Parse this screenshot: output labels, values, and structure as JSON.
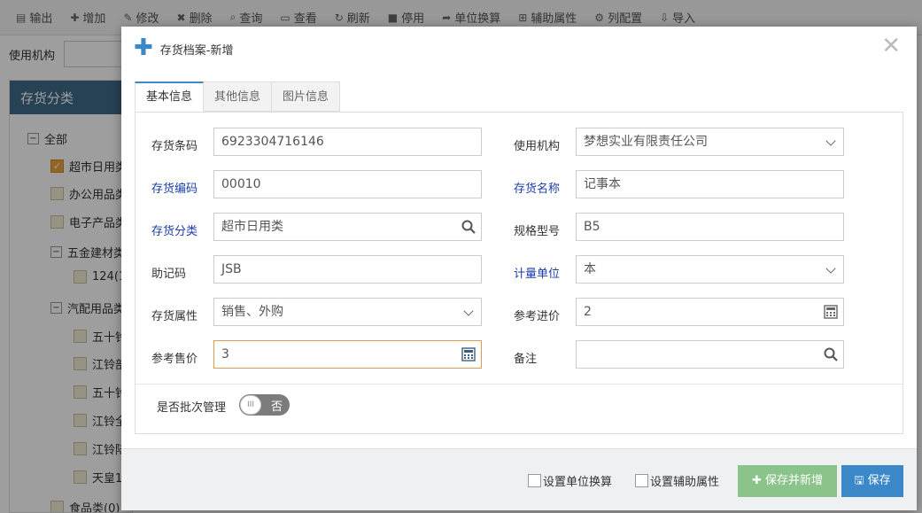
{
  "toolbar": {
    "items": [
      {
        "icon": "export-icon",
        "glyph": "▤",
        "label": "输出"
      },
      {
        "icon": "add-icon",
        "glyph": "✚",
        "label": "增加"
      },
      {
        "icon": "edit-icon",
        "glyph": "✎",
        "label": "修改"
      },
      {
        "icon": "delete-icon",
        "glyph": "✖",
        "label": "删除"
      },
      {
        "icon": "search-icon",
        "glyph": "⌕",
        "label": "查询"
      },
      {
        "icon": "view-icon",
        "glyph": "▭",
        "label": "查看"
      },
      {
        "icon": "refresh-icon",
        "glyph": "↻",
        "label": "刷新"
      },
      {
        "icon": "disable-icon",
        "glyph": "■",
        "label": "停用"
      },
      {
        "icon": "share-icon",
        "glyph": "➦",
        "label": "单位换算"
      },
      {
        "icon": "sitemap-icon",
        "glyph": "⊞",
        "label": "辅助属性"
      },
      {
        "icon": "gear-icon",
        "glyph": "⚙",
        "label": "列配置"
      },
      {
        "icon": "import-icon",
        "glyph": "⇩",
        "label": "导入"
      }
    ]
  },
  "org_filter": {
    "label": "使用机构",
    "value": ""
  },
  "tree": {
    "title": "存货分类",
    "nodes": [
      {
        "text": "全部"
      },
      {
        "text": "超市日用类"
      },
      {
        "text": "办公用品类"
      },
      {
        "text": "电子产品类"
      },
      {
        "text": "五金建材类"
      },
      {
        "text": "124(1",
        "suffix": ""
      },
      {
        "text": "汽配用品类"
      },
      {
        "text": "五十铃"
      },
      {
        "text": "江铃部"
      },
      {
        "text": "五十铃"
      },
      {
        "text": "江铃全"
      },
      {
        "text": "江铃陆"
      },
      {
        "text": "天皇1"
      },
      {
        "text": "食品类(0)"
      }
    ]
  },
  "dialog": {
    "title": "存货档案-新增",
    "tabs": [
      "基本信息",
      "其他信息",
      "图片信息"
    ],
    "fields": {
      "barcode": {
        "label": "存货条码",
        "value": "6923304716146"
      },
      "org": {
        "label": "使用机构",
        "value": "梦想实业有限责任公司"
      },
      "code": {
        "label": "存货编码",
        "value": "00010"
      },
      "name": {
        "label": "存货名称",
        "value": "记事本"
      },
      "category": {
        "label": "存货分类",
        "value": "超市日用类"
      },
      "spec": {
        "label": "规格型号",
        "value": "B5"
      },
      "mnemonic": {
        "label": "助记码",
        "value": "JSB"
      },
      "unit": {
        "label": "计量单位",
        "value": "本"
      },
      "attr": {
        "label": "存货属性",
        "value": "销售、外购"
      },
      "cost": {
        "label": "参考进价",
        "value": "2"
      },
      "price": {
        "label": "参考售价",
        "value": "3"
      },
      "remark": {
        "label": "备注",
        "value": ""
      }
    },
    "batch": {
      "label": "是否批次管理",
      "toggle_knob": "III",
      "toggle_text": "否"
    },
    "footer": {
      "unit_conv_label": "设置单位换算",
      "aux_attr_label": "设置辅助属性",
      "save_new_label": "保存并新增",
      "save_label": "保存"
    }
  },
  "colors": {
    "accent": "#3a88c8",
    "required_label": "#1b3ea8",
    "save_new": "#8bc48a",
    "focus_border": "#e29a4c"
  }
}
